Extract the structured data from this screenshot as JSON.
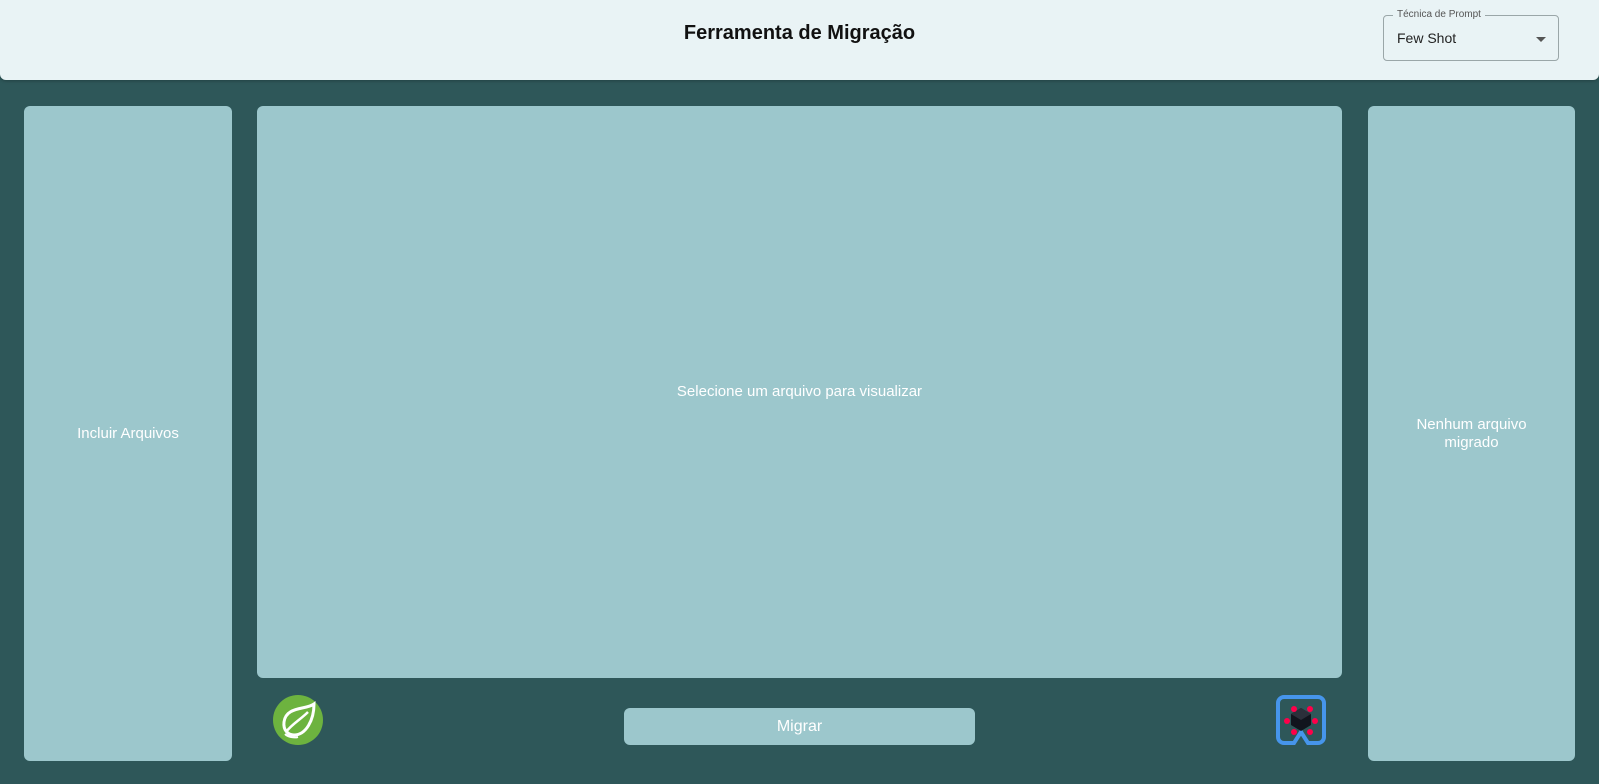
{
  "header": {
    "title": "Ferramenta de Migração",
    "prompt_select": {
      "label": "Técnica de Prompt",
      "value": "Few Shot"
    }
  },
  "left_panel": {
    "label": "Incluir Arquivos"
  },
  "center_panel": {
    "placeholder": "Selecione um arquivo para visualizar"
  },
  "right_panel": {
    "label": "Nenhum arquivo migrado"
  },
  "footer": {
    "migrate_label": "Migrar",
    "source_logo": "spring-logo",
    "target_logo": "quarkus-logo"
  },
  "colors": {
    "background": "#2e5759",
    "header": "#e9f3f5",
    "panel": "#9cc7cc",
    "spring_green": "#6db33f",
    "quarkus_blue": "#4695eb",
    "quarkus_red": "#ff004a"
  }
}
